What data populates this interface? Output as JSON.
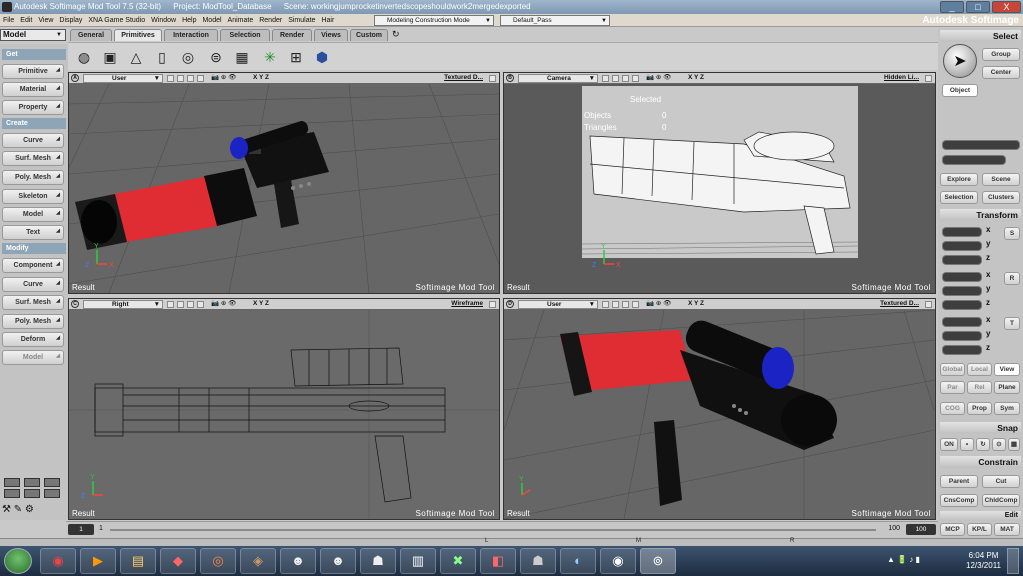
{
  "window": {
    "title": "Autodesk Softimage Mod Tool 7.5 (32-bit)",
    "project": "Project: ModTool_Database",
    "scene": "Scene: workingjumprocketinvertedscopeshouldwork2mergedexported",
    "controls": [
      "_",
      "□",
      "X"
    ]
  },
  "menu": [
    "File",
    "Edit",
    "View",
    "Display",
    "XNA Game Studio",
    "Window",
    "Help",
    "Model",
    "Animate",
    "Render",
    "Simulate",
    "Hair"
  ],
  "layout_combo": "Modeling Construction Mode",
  "pass_combo": "Default_Pass",
  "brand": "Autodesk Softimage",
  "module": "Model",
  "tabs": [
    "General",
    "Primitives",
    "Interaction",
    "Selection",
    "Render",
    "Views",
    "Custom"
  ],
  "primitive_icons": [
    "sphere-icon",
    "cube-icon",
    "cone-icon",
    "cylinder-icon",
    "torus-icon",
    "disc-icon",
    "grid-icon",
    "null-icon",
    "lattice-icon",
    "dodecahedron-icon"
  ],
  "left": {
    "get": "Get",
    "get_items": [
      "Primitive",
      "Material",
      "Property"
    ],
    "create": "Create",
    "create_items": [
      "Curve",
      "Surf. Mesh",
      "Poly. Mesh",
      "Skeleton",
      "Model",
      "Text"
    ],
    "modify": "Modify",
    "modify_items": [
      "Component",
      "Curve",
      "Surf. Mesh",
      "Poly. Mesh",
      "Deform",
      "Model"
    ]
  },
  "viewports": [
    {
      "letter": "A",
      "camera": "User",
      "mode": "Textured D...",
      "result": "Result",
      "tag": "Softimage Mod Tool"
    },
    {
      "letter": "B",
      "camera": "Camera",
      "mode": "Hidden Li...",
      "result": "Result",
      "tag": "Softimage Mod Tool",
      "hud": {
        "selected": "Selected",
        "objects_label": "Objects",
        "objects_value": "0",
        "triangles_label": "Triangles",
        "triangles_value": "0"
      }
    },
    {
      "letter": "C",
      "camera": "Right",
      "mode": "Wireframe",
      "result": "Result",
      "tag": "Softimage Mod Tool"
    },
    {
      "letter": "D",
      "camera": "User",
      "mode": "Textured D...",
      "result": "Result",
      "tag": "Softimage Mod Tool"
    }
  ],
  "viewport_axes": "X Y Z",
  "right": {
    "select": "Select",
    "group": "Group",
    "center": "Center",
    "object": "Object",
    "explore": "Explore",
    "scene": "Scene",
    "selection": "Selection",
    "clusters": "Clusters",
    "transform": "Transform",
    "srt_letters": [
      "S",
      "R",
      "T"
    ],
    "axis_letters": [
      "x",
      "y",
      "z"
    ],
    "global": "Global",
    "local": "Local",
    "view": "View",
    "par": "Par",
    "rel": "Rel",
    "plane": "Plane",
    "cog": "COG",
    "prop": "Prop",
    "sym": "Sym",
    "snap": "Snap",
    "on": "ON",
    "constrain": "Constrain",
    "parent": "Parent",
    "cut": "Cut",
    "cnscomp": "CnsComp",
    "chldcomp": "ChldComp",
    "edit": "Edit",
    "mcp": "MCP",
    "kpl": "KP/L",
    "mat": "MAT"
  },
  "timeline": {
    "start": "1",
    "current": "1",
    "end": "100",
    "end2": "100"
  },
  "bottom_markers": [
    "L",
    "M",
    "R"
  ],
  "taskbar": {
    "time": "6:04 PM",
    "date": "12/3/2011"
  }
}
